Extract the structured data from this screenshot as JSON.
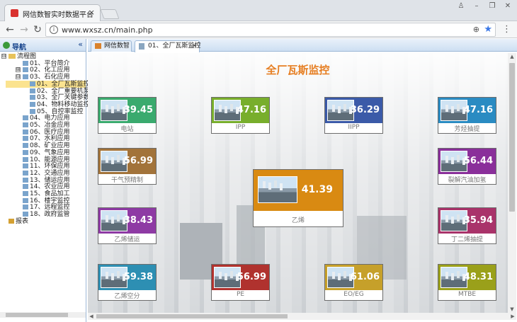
{
  "browser": {
    "tab_title": "网信数智实时数据平台",
    "tab_close": "×",
    "url": "www.wxsz.cn/main.php"
  },
  "nav": {
    "title": "导航",
    "collapse": "«",
    "items": [
      {
        "label": "流程图",
        "level": 0,
        "expander": "⊟",
        "icon": "folder"
      },
      {
        "label": "01、平台简介",
        "level": 1,
        "expander": "",
        "icon": "chart"
      },
      {
        "label": "02、化工应用",
        "level": 1,
        "expander": "⊞",
        "icon": "chart"
      },
      {
        "label": "03、石化应用",
        "level": 1,
        "expander": "⊟",
        "icon": "chart"
      },
      {
        "label": "01、全厂瓦斯监控",
        "level": 2,
        "expander": "",
        "icon": "chart",
        "selected": true
      },
      {
        "label": "02、全厂重要机泵监控",
        "level": 2,
        "expander": "",
        "icon": "chart"
      },
      {
        "label": "03、全厂关键参数监控",
        "level": 2,
        "expander": "",
        "icon": "chart"
      },
      {
        "label": "04、物料移动监控",
        "level": 2,
        "expander": "",
        "icon": "chart"
      },
      {
        "label": "05、自控率监控",
        "level": 2,
        "expander": "",
        "icon": "chart"
      },
      {
        "label": "04、电力应用",
        "level": 1,
        "expander": "",
        "icon": "chart"
      },
      {
        "label": "05、冶金应用",
        "level": 1,
        "expander": "",
        "icon": "chart"
      },
      {
        "label": "06、医疗应用",
        "level": 1,
        "expander": "",
        "icon": "chart"
      },
      {
        "label": "07、水利应用",
        "level": 1,
        "expander": "",
        "icon": "chart"
      },
      {
        "label": "08、矿业应用",
        "level": 1,
        "expander": "",
        "icon": "chart"
      },
      {
        "label": "09、气象应用",
        "level": 1,
        "expander": "",
        "icon": "chart"
      },
      {
        "label": "10、能源应用",
        "level": 1,
        "expander": "",
        "icon": "chart"
      },
      {
        "label": "11、环保应用",
        "level": 1,
        "expander": "",
        "icon": "chart"
      },
      {
        "label": "12、交通应用",
        "level": 1,
        "expander": "",
        "icon": "chart"
      },
      {
        "label": "13、储运应用",
        "level": 1,
        "expander": "",
        "icon": "chart"
      },
      {
        "label": "14、农业应用",
        "level": 1,
        "expander": "",
        "icon": "chart"
      },
      {
        "label": "15、食品加工",
        "level": 1,
        "expander": "",
        "icon": "chart"
      },
      {
        "label": "16、楼宇监控",
        "level": 1,
        "expander": "",
        "icon": "chart"
      },
      {
        "label": "17、远程监控",
        "level": 1,
        "expander": "",
        "icon": "chart"
      },
      {
        "label": "18、政府监管",
        "level": 1,
        "expander": "",
        "icon": "chart"
      },
      {
        "label": "报表",
        "level": 0,
        "expander": "",
        "icon": "report"
      }
    ]
  },
  "content_tabs": [
    {
      "label": "网信数智",
      "icon": "home",
      "closable": false
    },
    {
      "label": "01、全厂瓦斯监控",
      "icon": "page",
      "closable": true,
      "active": true
    }
  ],
  "close_glyph": "×",
  "page_title": "全厂瓦斯监控",
  "tiles": [
    {
      "name": "电站",
      "value": "39.45",
      "color": "#3aaa6e"
    },
    {
      "name": "IPP",
      "value": "47.16",
      "color": "#78ae2c"
    },
    {
      "name": "IIPP",
      "value": "36.29",
      "color": "#3b5aa8"
    },
    {
      "name": "芳烃抽提",
      "value": "47.16",
      "color": "#2a8bc2"
    },
    {
      "name": "干气预精制",
      "value": "56.99",
      "color": "#a2733a"
    },
    {
      "name": "裂解汽油加氢",
      "value": "56.44",
      "color": "#8a2f9a"
    },
    {
      "name": "乙烯",
      "value": "41.39",
      "color": "#d98a12",
      "big": true
    },
    {
      "name": "乙烯储运",
      "value": "38.43",
      "color": "#8e3aa4"
    },
    {
      "name": "丁二烯抽提",
      "value": "35.94",
      "color": "#a9336a"
    },
    {
      "name": "乙烯空分",
      "value": "59.38",
      "color": "#2d8fb3"
    },
    {
      "name": "PE",
      "value": "56.99",
      "color": "#b0322e"
    },
    {
      "name": "EO/EG",
      "value": "61.06",
      "color": "#c6a02a"
    },
    {
      "name": "MTBE",
      "value": "48.31",
      "color": "#9aa01a"
    }
  ]
}
